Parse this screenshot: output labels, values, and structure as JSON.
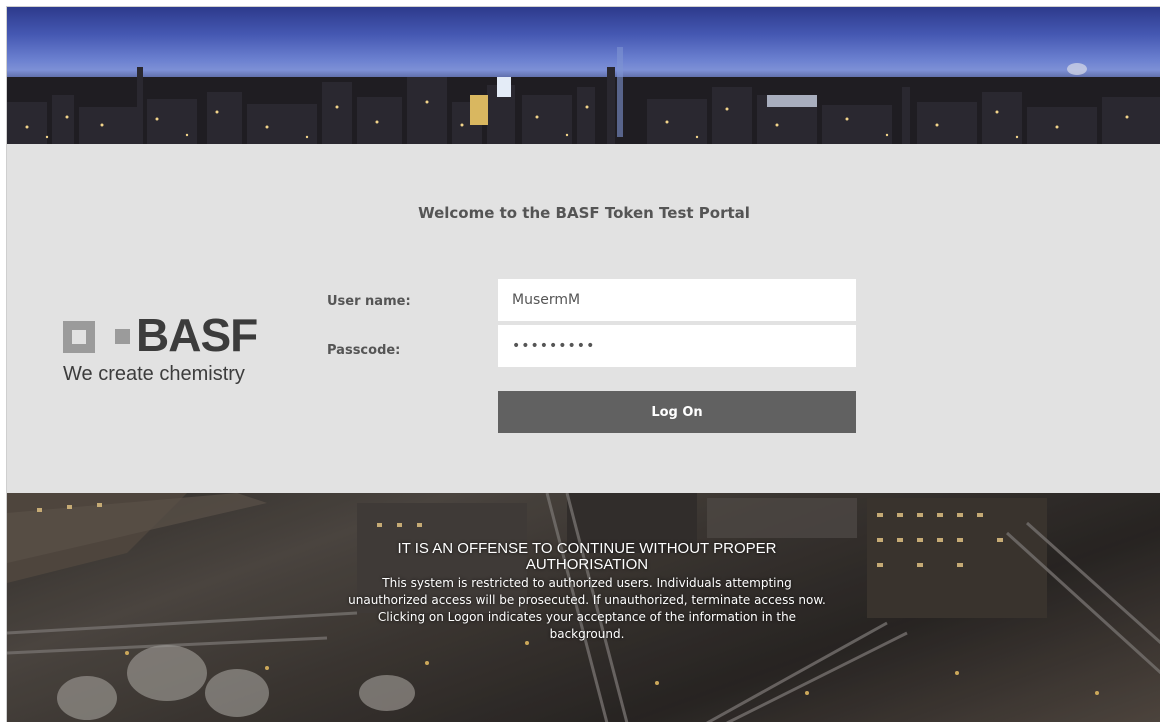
{
  "portal": {
    "welcome_text": "Welcome to the BASF Token Test Portal"
  },
  "brand": {
    "wordmark": "BASF",
    "tagline": "We create chemistry"
  },
  "form": {
    "username_label": "User name:",
    "username_value": "MusermM",
    "passcode_label": "Passcode:",
    "passcode_value": "•••••••••",
    "logon_label": "Log On"
  },
  "notice": {
    "title": "IT IS AN OFFENSE TO CONTINUE WITHOUT PROPER AUTHORISATION",
    "body": "This system is restricted to authorized users. Individuals attempting unauthorized access will be prosecuted. If unauthorized, terminate access now. Clicking on Logon indicates your acceptance of the information in the background."
  },
  "colors": {
    "login_background": "#e2e2e2",
    "button_background": "#616161",
    "logo_grey": "#9b9b9b",
    "text_grey": "#555555"
  }
}
